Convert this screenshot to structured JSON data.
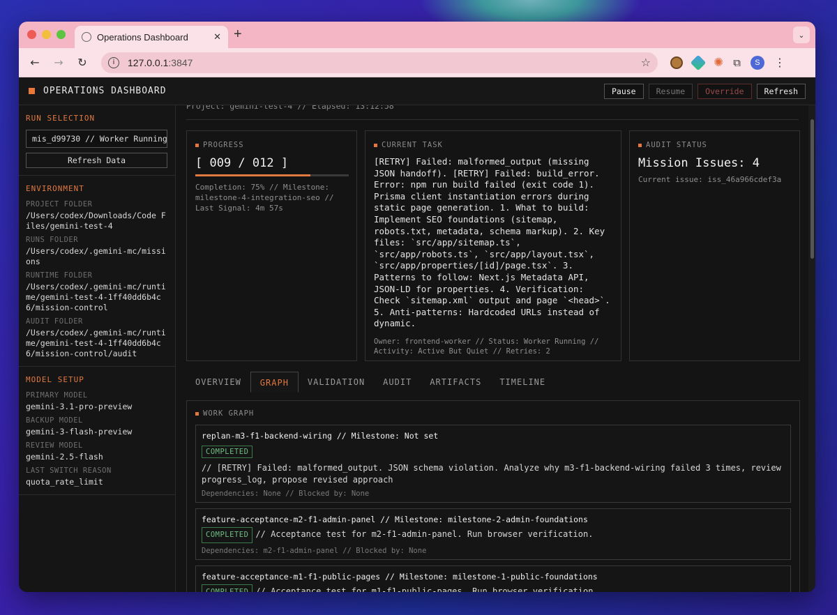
{
  "browser": {
    "tab_title": "Operations Dashboard",
    "tab_close": "✕",
    "new_tab": "+",
    "tab_menu": "⌄",
    "url_host": "127.0.0.1",
    "url_port": ":3847",
    "profile_initial": "S",
    "nav": {
      "back": "←",
      "forward": "→",
      "reload": "↻"
    },
    "star": "☆",
    "info": "i",
    "kebab": "⋮"
  },
  "app": {
    "title": "OPERATIONS DASHBOARD",
    "actions": {
      "pause": "Pause",
      "resume": "Resume",
      "override": "Override",
      "refresh": "Refresh"
    }
  },
  "sidebar": {
    "run_selection": {
      "title": "RUN SELECTION",
      "selected_run": "mis_d99730 // Worker Running",
      "refresh_label": "Refresh Data"
    },
    "environment": {
      "title": "ENVIRONMENT",
      "project_folder_label": "PROJECT FOLDER",
      "project_folder": "/Users/codex/Downloads/Code Files/gemini-test-4",
      "runs_folder_label": "RUNS FOLDER",
      "runs_folder": "/Users/codex/.gemini-mc/missions",
      "runtime_folder_label": "RUNTIME FOLDER",
      "runtime_folder": "/Users/codex/.gemini-mc/runtime/gemini-test-4-1ff40dd6b4c6/mission-control",
      "audit_folder_label": "AUDIT FOLDER",
      "audit_folder": "/Users/codex/.gemini-mc/runtime/gemini-test-4-1ff40dd6b4c6/mission-control/audit"
    },
    "model_setup": {
      "title": "MODEL SETUP",
      "primary_label": "PRIMARY MODEL",
      "primary": "gemini-3.1-pro-preview",
      "backup_label": "BACKUP MODEL",
      "backup": "gemini-3-flash-preview",
      "review_label": "REVIEW MODEL",
      "review": "gemini-2.5-flash",
      "switch_label": "LAST SWITCH REASON",
      "switch": "quota_rate_limit"
    }
  },
  "main": {
    "project_line": "Project: gemini-test-4 // Elapsed: 13:12:58",
    "progress": {
      "title": "PROGRESS",
      "value": "[ 009 / 012 ]",
      "fraction": 0.75,
      "completion": "Completion: 75% // Milestone: milestone-4-integration-seo // Last Signal: 4m 57s"
    },
    "current_task": {
      "title": "CURRENT TASK",
      "body": "[RETRY] Failed: malformed_output (missing JSON handoff). [RETRY] Failed: build_error. Error: npm run build failed (exit code 1). Prisma client instantiation errors during static page generation. 1. What to build: Implement SEO foundations (sitemap, robots.txt, metadata, schema markup). 2. Key files: `src/app/sitemap.ts`, `src/app/robots.ts`, `src/app/layout.tsx`, `src/app/properties/[id]/page.tsx`. 3. Patterns to follow: Next.js Metadata API, JSON-LD for properties. 4. Verification: Check `sitemap.xml` output and page `<head>`. 5. Anti-patterns: Hardcoded URLs instead of dynamic.",
      "meta": "Owner: frontend-worker // Status: Worker Running // Activity: Active But Quiet // Retries: 2"
    },
    "audit_status": {
      "title": "AUDIT STATUS",
      "headline": "Mission Issues: 4",
      "current_issue": "Current issue: iss_46a966cdef3a"
    },
    "tabs": [
      "OVERVIEW",
      "GRAPH",
      "VALIDATION",
      "AUDIT",
      "ARTIFACTS",
      "TIMELINE"
    ],
    "work_graph": {
      "title": "WORK GRAPH",
      "nodes": [
        {
          "title": "replan-m3-f1-backend-wiring // Milestone: Not set",
          "status": "COMPLETED",
          "desc": "// [RETRY] Failed: malformed_output. JSON schema violation. Analyze why m3-f1-backend-wiring failed 3 times, review progress_log, propose revised approach",
          "deps": "Dependencies: None // Blocked by: None"
        },
        {
          "title": "feature-acceptance-m2-f1-admin-panel // Milestone: milestone-2-admin-foundations",
          "status": "COMPLETED",
          "desc": "// Acceptance test for m2-f1-admin-panel. Run browser verification.",
          "deps": "Dependencies: m2-f1-admin-panel // Blocked by: None"
        },
        {
          "title": "feature-acceptance-m1-f1-public-pages // Milestone: milestone-1-public-foundations",
          "status": "COMPLETED",
          "desc": "// Acceptance test for m1-f1-public-pages. Run browser verification.",
          "deps": ""
        }
      ]
    }
  },
  "colors": {
    "accent": "#e2793f",
    "completed": "#6fbf84",
    "chrome": "#f4b6c4"
  }
}
